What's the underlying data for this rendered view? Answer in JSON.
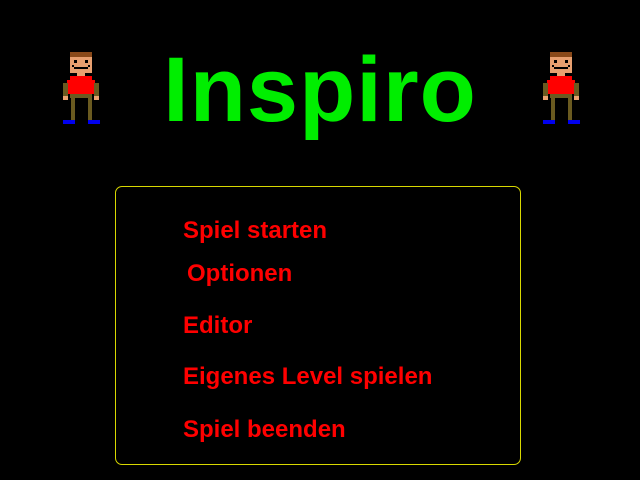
{
  "game": {
    "title": "Inspiro",
    "colors": {
      "background": "#000000",
      "title": "#00ee00",
      "menu_text": "#ff0000",
      "panel_border": "#d8d800"
    }
  },
  "sprites": {
    "left": "player-character-sprite",
    "right": "player-character-sprite"
  },
  "menu": {
    "items": [
      {
        "label": "Spiel starten"
      },
      {
        "label": "Optionen"
      },
      {
        "label": "Editor"
      },
      {
        "label": "Eigenes Level spielen"
      },
      {
        "label": "Spiel beenden"
      }
    ]
  }
}
